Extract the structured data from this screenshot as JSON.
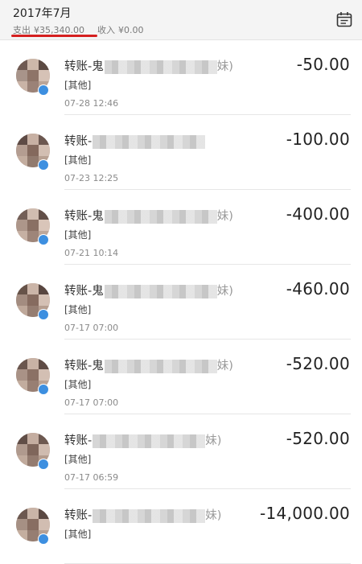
{
  "header": {
    "month": "2017年7月",
    "expense_label": "支出",
    "expense_amount": "¥35,340.00",
    "income_label": "收入",
    "income_amount": "¥0.00",
    "calendar_icon": "calendar-icon",
    "underline_color": "#d51f1f"
  },
  "transactions": [
    {
      "title": "转账-鬼",
      "tail": "妹)",
      "category": "[其他]",
      "time": "07-28  12:46",
      "amount": "-50.00"
    },
    {
      "title": "转账-",
      "tail": "",
      "category": "[其他]",
      "time": "07-23  12:25",
      "amount": "-100.00"
    },
    {
      "title": "转账-鬼",
      "tail": "妹)",
      "category": "[其他]",
      "time": "07-21  10:14",
      "amount": "-400.00"
    },
    {
      "title": "转账-鬼",
      "tail": "妹)",
      "category": "[其他]",
      "time": "07-17  07:00",
      "amount": "-460.00"
    },
    {
      "title": "转账-鬼",
      "tail": "妹)",
      "category": "[其他]",
      "time": "07-17  07:00",
      "amount": "-520.00"
    },
    {
      "title": "转账-",
      "tail": "妹)",
      "category": "[其他]",
      "time": "07-17  06:59",
      "amount": "-520.00"
    },
    {
      "title": "转账-",
      "tail": "妹)",
      "category": "[其他]",
      "time": "",
      "amount": "-14,000.00"
    }
  ],
  "colors": {
    "badge": "#3d8fe0",
    "header_bg": "#f4f4f4"
  }
}
